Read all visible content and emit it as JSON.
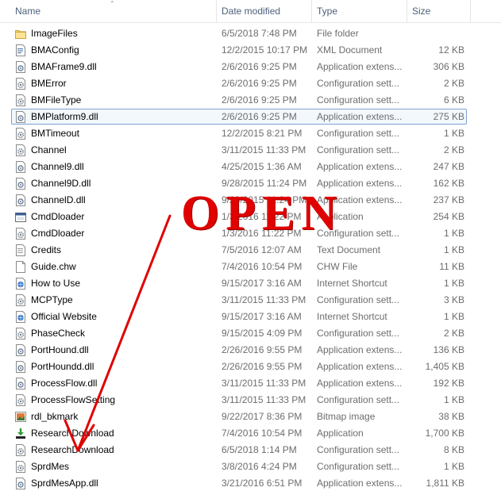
{
  "header": {
    "name": "Name",
    "date_modified": "Date modified",
    "type": "Type",
    "size": "Size"
  },
  "files": [
    {
      "name": "ImageFiles",
      "date": "6/5/2018 7:48 PM",
      "type": "File folder",
      "size": "",
      "icon": "folder-icon"
    },
    {
      "name": "BMAConfig",
      "date": "12/2/2015 10:17 PM",
      "type": "XML Document",
      "size": "12 KB",
      "icon": "xml-file-icon"
    },
    {
      "name": "BMAFrame9.dll",
      "date": "2/6/2016 9:25 PM",
      "type": "Application extens...",
      "size": "306 KB",
      "icon": "dll-file-icon"
    },
    {
      "name": "BMError",
      "date": "2/6/2016 9:25 PM",
      "type": "Configuration sett...",
      "size": "2 KB",
      "icon": "config-file-icon"
    },
    {
      "name": "BMFileType",
      "date": "2/6/2016 9:25 PM",
      "type": "Configuration sett...",
      "size": "6 KB",
      "icon": "config-file-icon"
    },
    {
      "name": "BMPlatform9.dll",
      "date": "2/6/2016 9:25 PM",
      "type": "Application extens...",
      "size": "275 KB",
      "icon": "dll-file-icon"
    },
    {
      "name": "BMTimeout",
      "date": "12/2/2015 8:21 PM",
      "type": "Configuration sett...",
      "size": "1 KB",
      "icon": "config-file-icon"
    },
    {
      "name": "Channel",
      "date": "3/11/2015 11:33 PM",
      "type": "Configuration sett...",
      "size": "2 KB",
      "icon": "config-file-icon"
    },
    {
      "name": "Channel9.dll",
      "date": "4/25/2015 1:36 AM",
      "type": "Application extens...",
      "size": "247 KB",
      "icon": "dll-file-icon"
    },
    {
      "name": "Channel9D.dll",
      "date": "9/28/2015 11:24 PM",
      "type": "Application extens...",
      "size": "162 KB",
      "icon": "dll-file-icon"
    },
    {
      "name": "ChannelD.dll",
      "date": "9/28/2015 11:24 PM",
      "type": "Application extens...",
      "size": "237 KB",
      "icon": "dll-file-icon"
    },
    {
      "name": "CmdDloader",
      "date": "1/3/2016 11:22 PM",
      "type": "Application",
      "size": "254 KB",
      "icon": "application-icon"
    },
    {
      "name": "CmdDloader",
      "date": "1/3/2016 11:22 PM",
      "type": "Configuration sett...",
      "size": "1 KB",
      "icon": "config-file-icon"
    },
    {
      "name": "Credits",
      "date": "7/5/2016 12:07 AM",
      "type": "Text Document",
      "size": "1 KB",
      "icon": "text-file-icon"
    },
    {
      "name": "Guide.chw",
      "date": "7/4/2016 10:54 PM",
      "type": "CHW File",
      "size": "11 KB",
      "icon": "generic-file-icon"
    },
    {
      "name": "How to Use",
      "date": "9/15/2017 3:16 AM",
      "type": "Internet Shortcut",
      "size": "1 KB",
      "icon": "internet-shortcut-icon"
    },
    {
      "name": "MCPType",
      "date": "3/11/2015 11:33 PM",
      "type": "Configuration sett...",
      "size": "3 KB",
      "icon": "config-file-icon"
    },
    {
      "name": "Official Website",
      "date": "9/15/2017 3:16 AM",
      "type": "Internet Shortcut",
      "size": "1 KB",
      "icon": "internet-shortcut-icon"
    },
    {
      "name": "PhaseCheck",
      "date": "9/15/2015 4:09 PM",
      "type": "Configuration sett...",
      "size": "2 KB",
      "icon": "config-file-icon"
    },
    {
      "name": "PortHound.dll",
      "date": "2/26/2016 9:55 PM",
      "type": "Application extens...",
      "size": "136 KB",
      "icon": "dll-file-icon"
    },
    {
      "name": "PortHoundd.dll",
      "date": "2/26/2016 9:55 PM",
      "type": "Application extens...",
      "size": "1,405 KB",
      "icon": "dll-file-icon"
    },
    {
      "name": "ProcessFlow.dll",
      "date": "3/11/2015 11:33 PM",
      "type": "Application extens...",
      "size": "192 KB",
      "icon": "dll-file-icon"
    },
    {
      "name": "ProcessFlowSetting",
      "date": "3/11/2015 11:33 PM",
      "type": "Configuration sett...",
      "size": "1 KB",
      "icon": "config-file-icon"
    },
    {
      "name": "rdl_bkmark",
      "date": "9/22/2017 8:36 PM",
      "type": "Bitmap image",
      "size": "38 KB",
      "icon": "bitmap-file-icon"
    },
    {
      "name": "ResearchDownload",
      "date": "7/4/2016 10:54 PM",
      "type": "Application",
      "size": "1,700 KB",
      "icon": "research-download-app-icon"
    },
    {
      "name": "ResearchDownload",
      "date": "6/5/2018 1:14 PM",
      "type": "Configuration sett...",
      "size": "8 KB",
      "icon": "config-file-icon"
    },
    {
      "name": "SprdMes",
      "date": "3/8/2016 4:24 PM",
      "type": "Configuration sett...",
      "size": "1 KB",
      "icon": "config-file-icon"
    },
    {
      "name": "SprdMesApp.dll",
      "date": "3/21/2016 6:51 PM",
      "type": "Application extens...",
      "size": "1,811 KB",
      "icon": "dll-file-icon"
    }
  ],
  "selected_index": 5,
  "annotation": {
    "text": "OPEN",
    "color": "#e00000"
  }
}
